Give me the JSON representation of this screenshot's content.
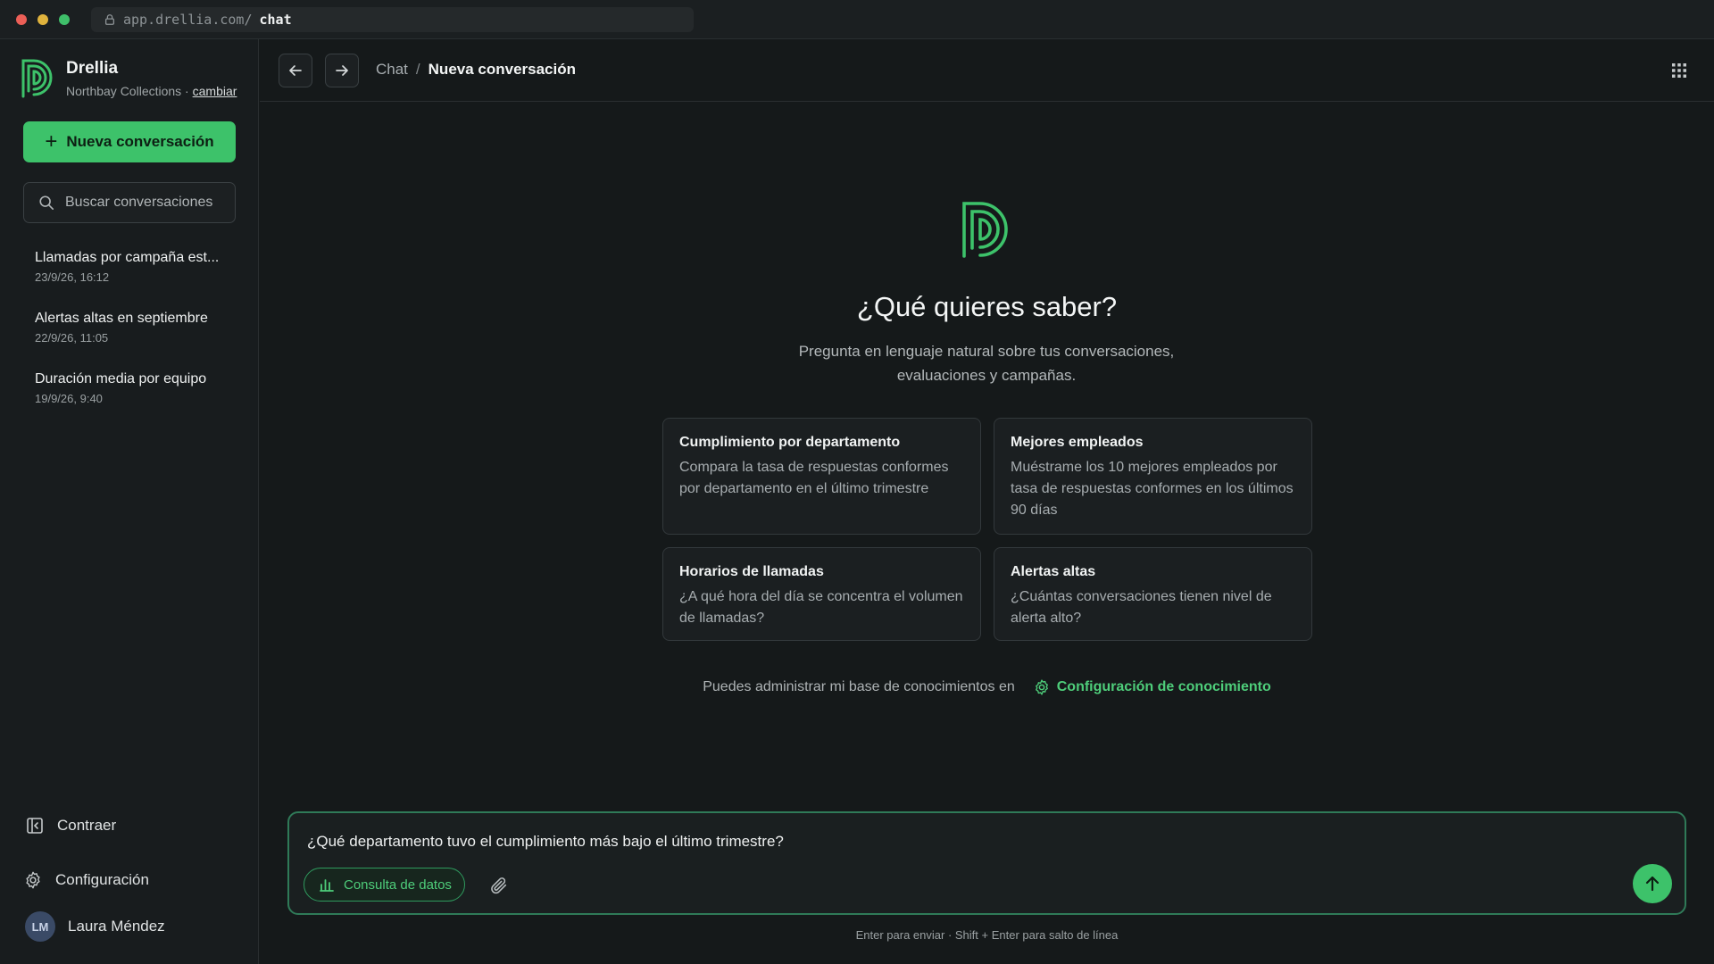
{
  "browser": {
    "url_host": "app.drellia.com/",
    "url_path": "chat"
  },
  "sidebar": {
    "brand_name": "Drellia",
    "workspace": "Northbay Collections ·",
    "switch_label": "cambiar",
    "new_chat_label": "Nueva conversación",
    "search_placeholder": "Buscar conversaciones",
    "conversations": [
      {
        "title": "Llamadas por campaña est...",
        "time": "23/9/26, 16:12"
      },
      {
        "title": "Alertas altas en septiembre",
        "time": "22/9/26, 11:05"
      },
      {
        "title": "Duración media por equipo",
        "time": "19/9/26, 9:40"
      }
    ],
    "collapse_label": "Contraer",
    "settings_label": "Configuración",
    "user_initials": "LM",
    "user_name": "Laura Méndez"
  },
  "topbar": {
    "breadcrumb_root": "Chat",
    "breadcrumb_separator": "/",
    "breadcrumb_current": "Nueva conversación"
  },
  "hero": {
    "title": "¿Qué quieres saber?",
    "subtitle": "Pregunta en lenguaje natural sobre tus conversaciones, evaluaciones y campañas."
  },
  "suggestions": [
    {
      "title": "Cumplimiento por departamento",
      "desc": "Compara la tasa de respuestas conformes por departamento en el último trimestre"
    },
    {
      "title": "Mejores empleados",
      "desc": "Muéstrame los 10 mejores empleados por tasa de respuestas conformes en los últimos 90 días"
    },
    {
      "title": "Horarios de llamadas",
      "desc": "¿A qué hora del día se concentra el volumen de llamadas?"
    },
    {
      "title": "Alertas altas",
      "desc": "¿Cuántas conversaciones tienen nivel de alerta alto?"
    }
  ],
  "knowledge": {
    "text": "Puedes administrar mi base de conocimientos en",
    "link_label": "Configuración de conocimiento"
  },
  "composer": {
    "value": "¿Qué departamento tuvo el cumplimiento más bajo el último trimestre?",
    "mode_label": "Consulta de datos",
    "hint": "Enter para enviar · Shift + Enter para salto de línea"
  },
  "colors": {
    "accent": "#3dc26a",
    "background": "#15191a",
    "sidebar": "#181c1e"
  }
}
